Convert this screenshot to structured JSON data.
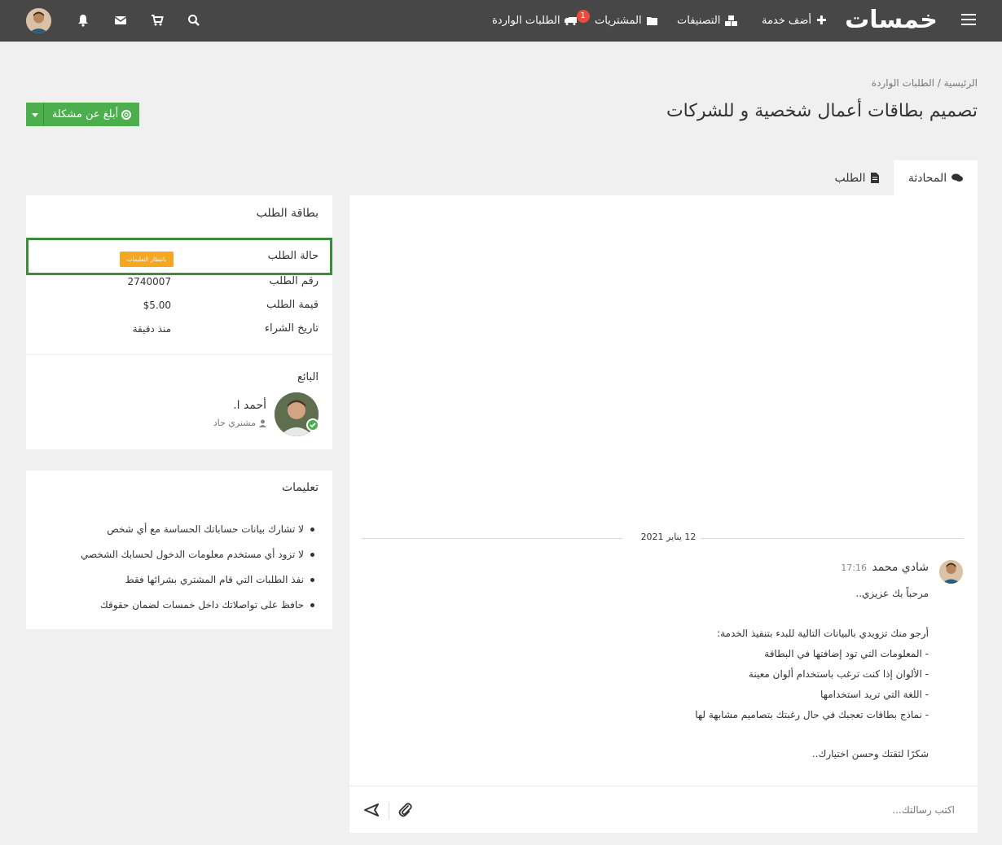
{
  "navbar": {
    "logo_text": "خمسات",
    "add_service": "أضف خدمة",
    "categories": "التصنيفات",
    "purchases": "المشتريات",
    "incoming_orders": "الطلبات الواردة",
    "incoming_badge": "1"
  },
  "breadcrumb": {
    "home": "الرئيسية",
    "separator": "/",
    "current": "الطلبات الواردة"
  },
  "page_title": "تصميم بطاقات أعمال شخصية و للشركات",
  "report_button": {
    "label": "أبلغ عن مشكلة"
  },
  "tabs": [
    {
      "label": "المحادثة",
      "active": true
    },
    {
      "label": "الطلب",
      "active": false
    }
  ],
  "chat": {
    "date_separator": "12 يناير 2021",
    "message": {
      "author": "شادي محمد",
      "time": "17:16",
      "lines": [
        "مرحباً بك عزيزي..",
        "أرجو منك تزويدي بالبيانات التالية للبدء بتنفيذ الخدمة:",
        "- المعلومات التي تود إضافتها في البطاقة",
        "- الألوان إذا كنت ترغب باستخدام ألوان معينة",
        "- اللغة التي تريد استخدامها",
        "- نماذج بطاقات تعجبك في حال رغبتك بتصاميم مشابهة لها",
        "شكرًا لثقتك وحسن اختيارك.."
      ]
    },
    "input_placeholder": "اكتب رسالتك..."
  },
  "order_card": {
    "title": "بطاقة الطلب",
    "status_label": "حالة الطلب",
    "status_value": "بانتظار التعليمات",
    "number_label": "رقم الطلب",
    "number_value": "2740007",
    "price_label": "قيمة الطلب",
    "price_value": "$5.00",
    "date_label": "تاريخ الشراء",
    "date_value": "منذ دقيقة",
    "seller_title": "البائع",
    "seller_name": "أحمد ا.",
    "seller_role": "مشتري جاد"
  },
  "instructions": {
    "title": "تعليمات",
    "items": [
      "لا تشارك بيانات حساباتك الحساسة مع أي شخص",
      "لا تزود أي مستخدم معلومات الدخول لحسابك الشخصي",
      "نفذ الطلبات التي قام المشتري بشرائها فقط",
      "حافظ على تواصلاتك داخل خمسات لضمان حقوقك"
    ]
  },
  "colors": {
    "navbar": "#474747",
    "accent_green": "#4cae4c",
    "status_orange": "#f5a623",
    "badge_red": "#e74c3c"
  }
}
